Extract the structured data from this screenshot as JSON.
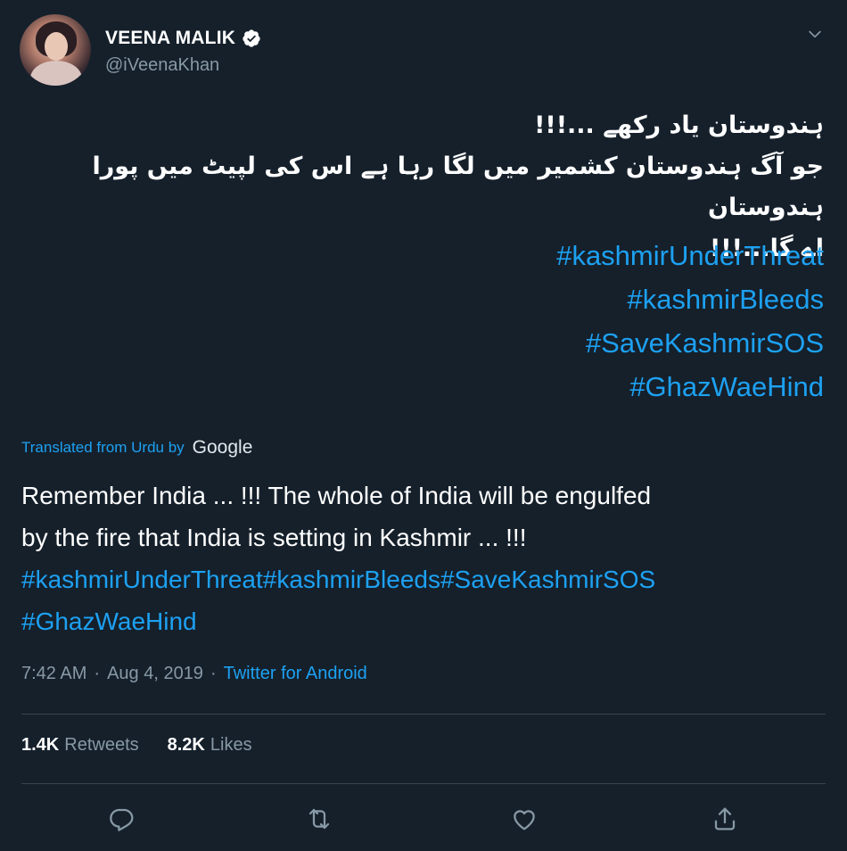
{
  "author": {
    "name": "VEENA MALIK",
    "handle": "@iVeenaKhan",
    "verified": true,
    "avatar_icon": "profile-photo"
  },
  "tweet": {
    "urdu_lines": [
      "ہندوستان یاد رکھے ...!!!",
      "جو آگ ہندوستان کشمیر میں لگا  رہا ہے اس کی لپیٹ میں پورا ہندوستان",
      "اے گا...!!!"
    ],
    "hashtags": [
      "#kashmirUnderThreat",
      "#kashmirBleeds",
      "#SaveKashmirSOS",
      "#GhazWaeHind"
    ]
  },
  "translation": {
    "label": "Translated from Urdu by",
    "provider": "Google",
    "text_line1": "Remember India ... !!! The whole of India will be engulfed",
    "text_line2": "by the fire that India is setting in Kashmir ... !!!",
    "tags_line": "#kashmirUnderThreat#kashmirBleeds#SaveKashmirSOS",
    "tags_line2": "#GhazWaeHind"
  },
  "meta": {
    "time": "7:42 AM",
    "separator": "·",
    "date": "Aug 4, 2019",
    "source": "Twitter for Android"
  },
  "stats": {
    "retweets_count": "1.4K",
    "retweets_label": "Retweets",
    "likes_count": "8.2K",
    "likes_label": "Likes"
  },
  "colors": {
    "background": "#15202b",
    "accent": "#1da1f2",
    "secondary_text": "#8899a6",
    "divider": "#38444d"
  },
  "icons": {
    "verified": "verified-badge-icon",
    "more": "chevron-down-icon",
    "reply": "reply-icon",
    "retweet": "retweet-icon",
    "like": "heart-icon",
    "share": "share-icon"
  }
}
